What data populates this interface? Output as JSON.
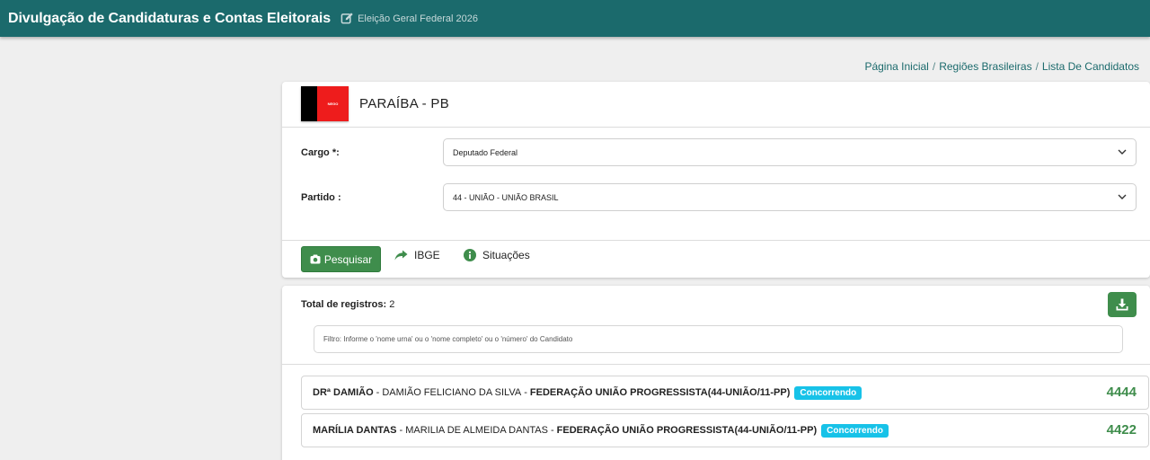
{
  "header": {
    "title": "Divulgação de Candidaturas e Contas Eleitorais",
    "election": "Eleição Geral Federal 2026",
    "bg_color": "#1b6a6c"
  },
  "breadcrumb": [
    "Página Inicial",
    "Regiões Brasileiras",
    "Lista De Candidatos"
  ],
  "state": {
    "name": "PARAÍBA - PB",
    "flag_text": "NEGO"
  },
  "form": {
    "cargo_label": "Cargo *:",
    "cargo_value": "Deputado Federal",
    "partido_label": "Partido :",
    "partido_value": "44 - UNIÃO - UNIÃO BRASIL"
  },
  "actions": {
    "search": "Pesquisar",
    "ibge": "IBGE",
    "situacoes": "Situações"
  },
  "results": {
    "total_label": "Total de registros:",
    "total_value": "2",
    "filter_placeholder": "Filtro: Informe o 'nome urna' ou o 'nome completo' ou o 'número' do Candidato",
    "candidates": [
      {
        "nickname": "DRª DAMIÃO",
        "full_name": "DAMIÃO FELICIANO DA SILVA",
        "party": "FEDERAÇÃO UNIÃO PROGRESSISTA(44-UNIÃO/11-PP)",
        "status": "Concorrendo",
        "number": "4444"
      },
      {
        "nickname": "MARÍLIA DANTAS",
        "full_name": "MARILIA DE ALMEIDA DANTAS",
        "party": "FEDERAÇÃO UNIÃO PROGRESSISTA(44-UNIÃO/11-PP)",
        "status": "Concorrendo",
        "number": "4422"
      }
    ]
  },
  "colors": {
    "accent_green": "#3f8d4c",
    "badge_cyan": "#17c2e8"
  }
}
